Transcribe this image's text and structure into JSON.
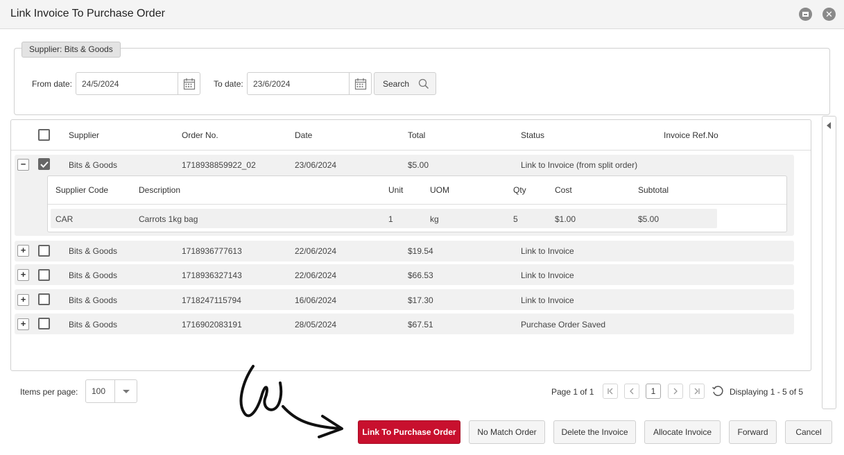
{
  "window": {
    "title": "Link Invoice To Purchase Order"
  },
  "filters": {
    "supplier_legend": "Supplier: Bits & Goods",
    "from_label": "From date:",
    "from_value": "24/5/2024",
    "to_label": "To date:",
    "to_value": "23/6/2024",
    "search_label": "Search"
  },
  "grid": {
    "columns": [
      "Supplier",
      "Order No.",
      "Date",
      "Total",
      "Status",
      "Invoice Ref.No"
    ],
    "rows": [
      {
        "expanded": true,
        "checked": true,
        "supplier": "Bits & Goods",
        "order_no": "1718938859922_02",
        "date": "23/06/2024",
        "total": "$5.00",
        "status": "Link to Invoice (from split order)",
        "invoice_ref": ""
      },
      {
        "expanded": false,
        "checked": false,
        "supplier": "Bits & Goods",
        "order_no": "1718936777613",
        "date": "22/06/2024",
        "total": "$19.54",
        "status": "Link to Invoice",
        "invoice_ref": ""
      },
      {
        "expanded": false,
        "checked": false,
        "supplier": "Bits & Goods",
        "order_no": "1718936327143",
        "date": "22/06/2024",
        "total": "$66.53",
        "status": "Link to Invoice",
        "invoice_ref": ""
      },
      {
        "expanded": false,
        "checked": false,
        "supplier": "Bits & Goods",
        "order_no": "1718247115794",
        "date": "16/06/2024",
        "total": "$17.30",
        "status": "Link to Invoice",
        "invoice_ref": ""
      },
      {
        "expanded": false,
        "checked": false,
        "supplier": "Bits & Goods",
        "order_no": "1716902083191",
        "date": "28/05/2024",
        "total": "$67.51",
        "status": "Purchase Order Saved",
        "invoice_ref": ""
      }
    ],
    "detail": {
      "columns": [
        "Supplier Code",
        "Description",
        "Unit",
        "UOM",
        "Qty",
        "Cost",
        "Subtotal"
      ],
      "items": [
        {
          "code": "CAR",
          "description": "Carrots 1kg bag",
          "unit": "1",
          "uom": "kg",
          "qty": "5",
          "cost": "$1.00",
          "subtotal": "$5.00"
        }
      ]
    }
  },
  "pager": {
    "items_per_page_label": "Items per page:",
    "items_per_page_value": "100",
    "page_info": "Page 1 of 1",
    "current_page": "1",
    "displaying": "Displaying 1 - 5 of 5"
  },
  "actions": {
    "link": "Link To Purchase Order",
    "no_match": "No Match Order",
    "delete": "Delete the Invoice",
    "allocate": "Allocate Invoice",
    "forward": "Forward",
    "cancel": "Cancel"
  },
  "colors": {
    "primary": "#c8102e"
  }
}
